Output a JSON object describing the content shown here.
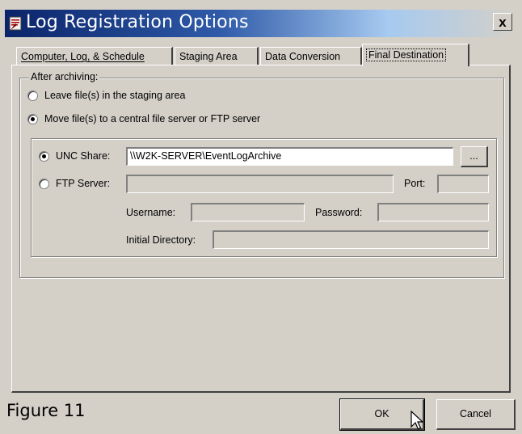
{
  "window": {
    "title": "Log Registration Options",
    "close_glyph": "x"
  },
  "tabs": [
    {
      "label": "Computer, Log, & Schedule",
      "active": false
    },
    {
      "label": "Staging Area",
      "active": false
    },
    {
      "label": "Data Conversion",
      "active": false
    },
    {
      "label": "Final Destination",
      "active": true
    }
  ],
  "after_archiving": {
    "legend": "After archiving:",
    "option_leave": "Leave file(s) in the staging area",
    "option_move": "Move file(s) to a central file server or FTP server",
    "selected": "move"
  },
  "destination": {
    "unc_label": "UNC Share:",
    "unc_value": "\\\\W2K-SERVER\\EventLogArchive",
    "browse_label": "...",
    "ftp_label": "FTP Server:",
    "ftp_value": "",
    "port_label": "Port:",
    "port_value": "",
    "username_label": "Username:",
    "username_value": "",
    "password_label": "Password:",
    "password_value": "",
    "initial_dir_label": "Initial Directory:",
    "initial_dir_value": "",
    "selected": "unc"
  },
  "footer": {
    "figure_label": "Figure 11",
    "ok_label": "OK",
    "cancel_label": "Cancel"
  },
  "icons": {
    "app_icon": "log-registration-icon",
    "cursor": "mouse-pointer-icon"
  }
}
